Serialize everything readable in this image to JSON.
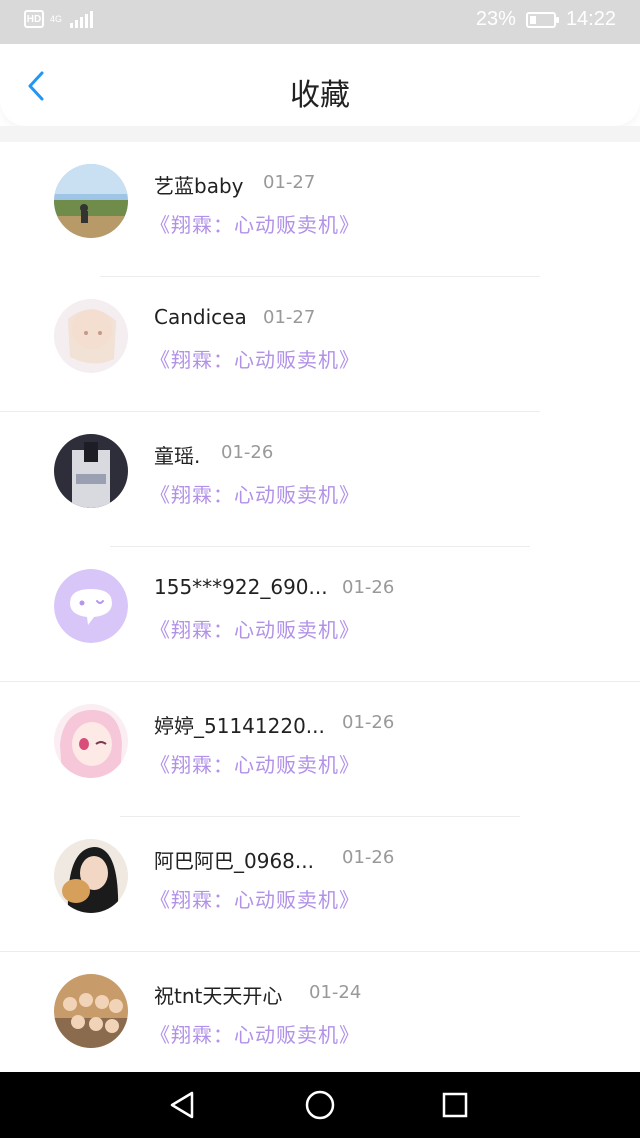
{
  "status_bar": {
    "hd": "HD",
    "network": "4G",
    "battery": "23%",
    "time": "14:22"
  },
  "header": {
    "title": "收藏"
  },
  "colors": {
    "accent": "#2196f3",
    "link_purple": "#b292e8",
    "date_gray": "#999999"
  },
  "items": [
    {
      "name": "艺蓝baby",
      "date": "01-27",
      "title": "《翔霖：心动贩卖机》",
      "avatar": "photo-landscape"
    },
    {
      "name": "Candicea",
      "date": "01-27",
      "title": "《翔霖：心动贩卖机》",
      "avatar": "photo-anime-light"
    },
    {
      "name": "童瑶.",
      "date": "01-26",
      "title": "《翔霖：心动贩卖机》",
      "avatar": "photo-dark"
    },
    {
      "name": "155***922_690...",
      "date": "01-26",
      "title": "《翔霖：心动贩卖机》",
      "avatar": "default-chat-bubble"
    },
    {
      "name": "婷婷_51141220...",
      "date": "01-26",
      "title": "《翔霖：心动贩卖机》",
      "avatar": "photo-anime-pink"
    },
    {
      "name": "阿巴阿巴_0968...",
      "date": "01-26",
      "title": "《翔霖：心动贩卖机》",
      "avatar": "photo-portrait"
    },
    {
      "name": "祝tnt天天开心",
      "date": "01-24",
      "title": "《翔霖：心动贩卖机》",
      "avatar": "photo-group"
    }
  ]
}
